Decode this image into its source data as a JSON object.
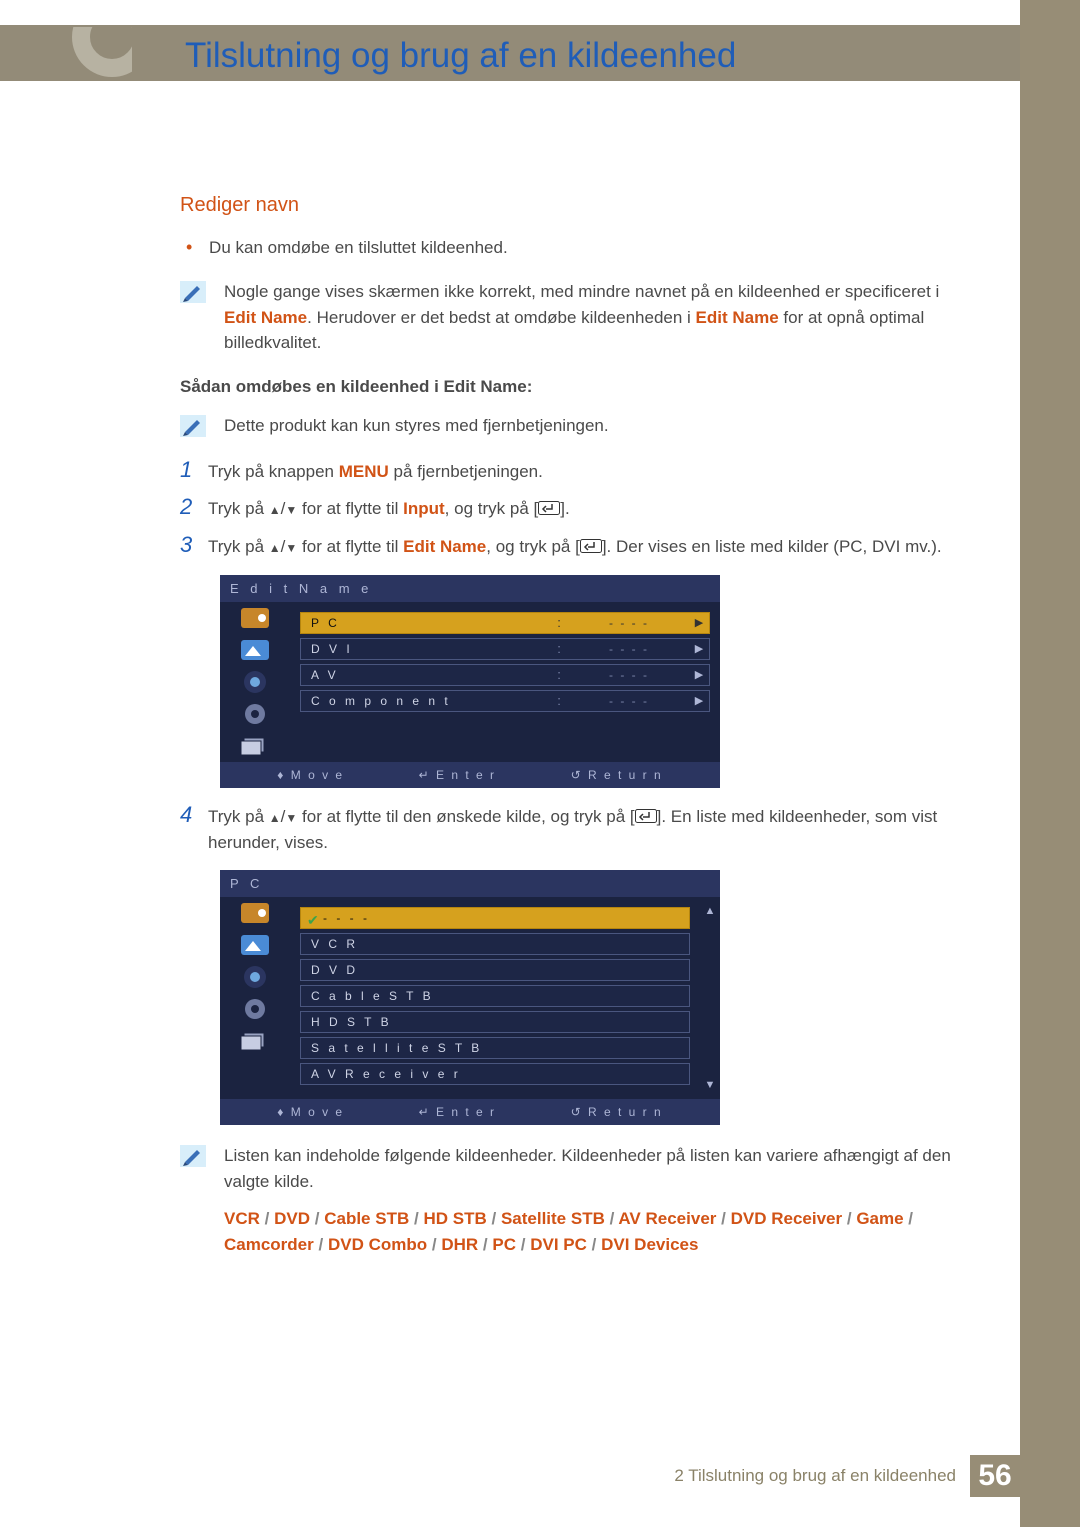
{
  "header": {
    "title": "Tilslutning og brug af en kildeenhed"
  },
  "section": {
    "heading": "Rediger navn",
    "bullet1": "Du kan omdøbe en tilsluttet kildeenhed.",
    "note1_a": "Nogle gange vises skærmen ikke korrekt, med mindre navnet på en kildeenhed er specificeret i ",
    "note1_hl1": "Edit Name",
    "note1_b": ". Herudover er det bedst at omdøbe kildeenheden i ",
    "note1_hl2": "Edit Name",
    "note1_c": " for at opnå optimal billedkvalitet.",
    "subheading": "Sådan omdøbes en kildeenhed i Edit Name:",
    "note2": "Dette produkt kan kun styres med fjernbetjeningen."
  },
  "steps": {
    "s1_num": "1",
    "s1_a": "Tryk på knappen ",
    "s1_hl": "MENU",
    "s1_b": " på fjernbetjeningen.",
    "s2_num": "2",
    "s2_a": "Tryk på ",
    "s2_b": " for at flytte til ",
    "s2_hl": "Input",
    "s2_c": ", og tryk på [",
    "s2_d": "].",
    "s3_num": "3",
    "s3_a": "Tryk på ",
    "s3_b": " for at flytte til ",
    "s3_hl": "Edit Name",
    "s3_c": ", og tryk på [",
    "s3_d": "]. Der vises en liste med kilder (PC, DVI mv.).",
    "s4_num": "4",
    "s4_a": "Tryk på ",
    "s4_b": " for at flytte til den ønskede kilde, og tryk på [",
    "s4_c": "]. En liste med kildeenheder, som vist herunder, vises."
  },
  "osd1": {
    "title": "E d i t  N a m e",
    "rows": [
      {
        "label": "P C",
        "val": "- - - -"
      },
      {
        "label": "D V I",
        "val": "- - - -"
      },
      {
        "label": "A V",
        "val": "- - - -"
      },
      {
        "label": "C o m p o n e n t",
        "val": "- - - -"
      }
    ],
    "footer": {
      "move": "M o v e",
      "enter": "E n t e r",
      "ret": "R e t u r n"
    }
  },
  "osd2": {
    "title": "P C",
    "rows": [
      {
        "label": "- - - -",
        "checked": true
      },
      {
        "label": "V C R"
      },
      {
        "label": "D V D"
      },
      {
        "label": "C a b l e  S T B"
      },
      {
        "label": "H D  S T B"
      },
      {
        "label": "S a t e l l i t e  S T B"
      },
      {
        "label": "A V  R e c e i v e r"
      }
    ],
    "footer": {
      "move": "M o v e",
      "enter": "E n t e r",
      "ret": "R e t u r n"
    }
  },
  "note3_a": "Listen kan indeholde følgende kildeenheder. Kildeenheder på listen kan variere afhængigt af den valgte kilde.",
  "devices": [
    "VCR",
    "DVD",
    "Cable STB",
    "HD STB",
    "Satellite STB",
    "AV Receiver",
    "DVD Receiver",
    "Game",
    "Camcorder",
    "DVD Combo",
    "DHR",
    "PC",
    "DVI PC",
    "DVI Devices"
  ],
  "footer": {
    "chapter_prefix": "2 ",
    "chapter_text": "Tilslutning og brug af en kildeenhed",
    "page": "56"
  }
}
